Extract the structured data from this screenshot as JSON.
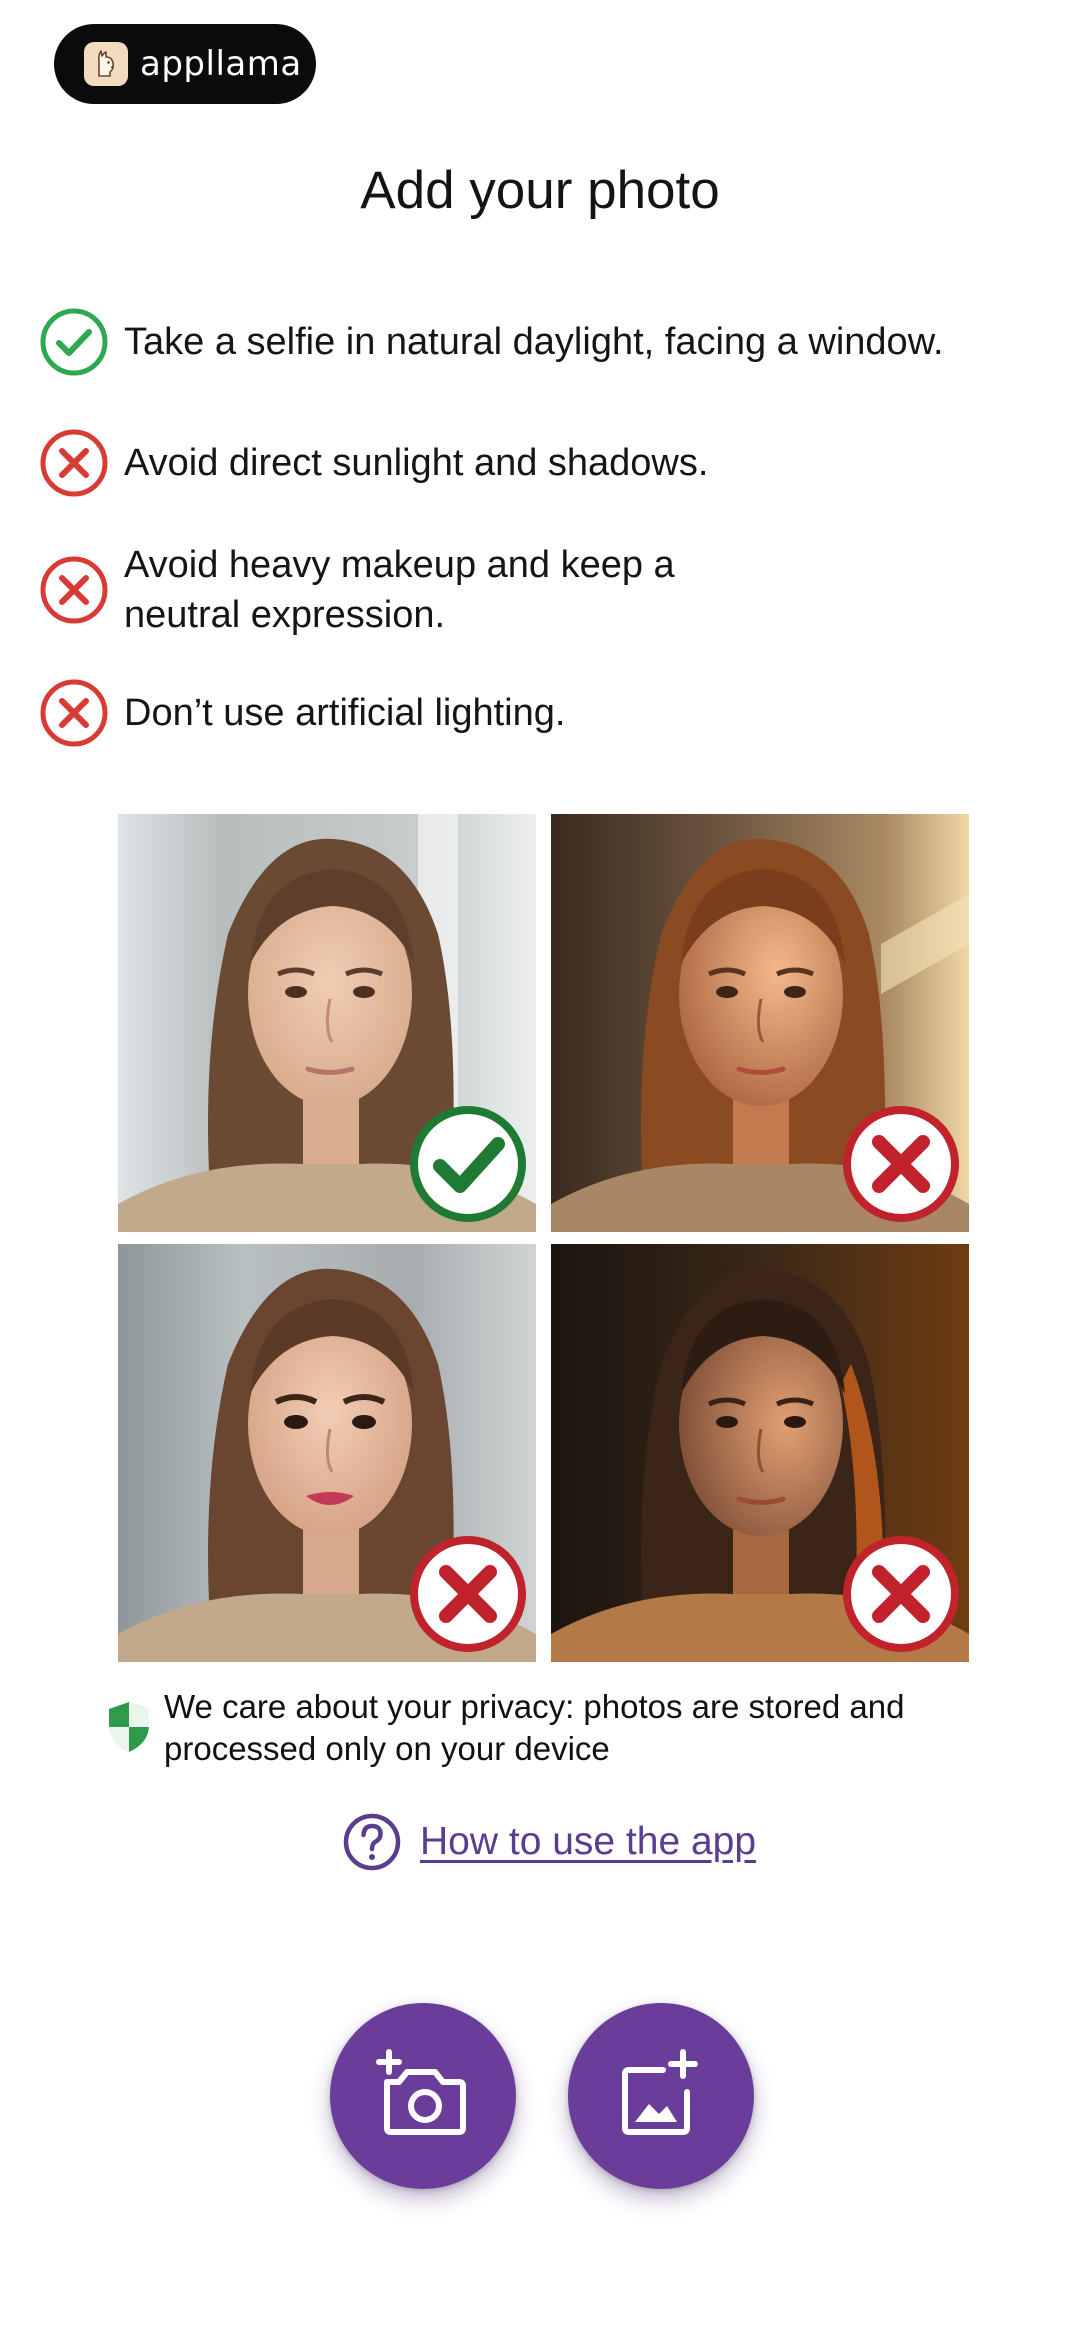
{
  "brand": {
    "name": "appllama",
    "icon": "llama-logo"
  },
  "title": "Add your photo",
  "guidelines": [
    {
      "status": "good",
      "icon": "check-circle-icon",
      "text": "Take a selfie in natural daylight, facing a window."
    },
    {
      "status": "bad",
      "icon": "x-circle-icon",
      "text": "Avoid direct sunlight and shadows."
    },
    {
      "status": "bad",
      "icon": "x-circle-icon",
      "text": "Avoid heavy makeup and keep a neutral expression."
    },
    {
      "status": "bad",
      "icon": "x-circle-icon",
      "text": "Don’t use artificial lighting."
    }
  ],
  "examples": [
    {
      "name": "natural-daylight",
      "status": "good",
      "badge_icon": "check-badge-icon"
    },
    {
      "name": "direct-sunlight",
      "status": "bad",
      "badge_icon": "x-badge-icon"
    },
    {
      "name": "heavy-makeup",
      "status": "bad",
      "badge_icon": "x-badge-icon"
    },
    {
      "name": "artificial-light",
      "status": "bad",
      "badge_icon": "x-badge-icon"
    }
  ],
  "privacy": {
    "icon": "shield-icon",
    "text": "We care about your privacy: photos are stored and processed only on your device"
  },
  "help": {
    "icon": "question-circle-icon",
    "label": "How to use the app"
  },
  "actions": [
    {
      "name": "take-photo-button",
      "icon": "add-camera-icon"
    },
    {
      "name": "add-from-gallery-button",
      "icon": "add-photo-icon"
    }
  ],
  "colors": {
    "good": "#2fa84f",
    "bad": "#d83a34",
    "accent": "#6a3d9a",
    "link": "#5b3d8f"
  }
}
